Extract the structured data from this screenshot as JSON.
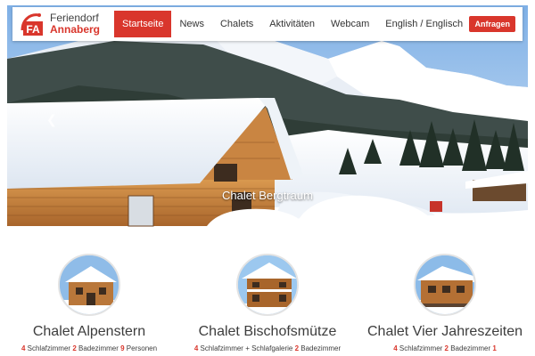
{
  "brand": {
    "line1": "Feriendorf",
    "line2": "Annaberg",
    "logo_letters": "FA"
  },
  "nav": {
    "items": [
      {
        "label": "Startseite",
        "active": true
      },
      {
        "label": "News",
        "active": false
      },
      {
        "label": "Chalets",
        "active": false
      },
      {
        "label": "Aktivitäten",
        "active": false
      },
      {
        "label": "Webcam",
        "active": false
      },
      {
        "label": "English / Englisch",
        "active": false
      }
    ],
    "cta_label": "Anfragen"
  },
  "hero": {
    "caption": "Chalet Bergtraum",
    "prev_icon": "chevron-left-icon"
  },
  "cards": [
    {
      "title": "Chalet Alpenstern",
      "meta": [
        {
          "num": "4",
          "text": " Schlafzimmer "
        },
        {
          "num": "2",
          "text": " Badezimmer "
        },
        {
          "num": "9",
          "text": " Personen"
        }
      ]
    },
    {
      "title": "Chalet Bischofsmütze",
      "meta": [
        {
          "num": "4",
          "text": " Schlafzimmer + Schlafgalerie "
        },
        {
          "num": "2",
          "text": " Badezimmer"
        }
      ]
    },
    {
      "title": "Chalet Vier Jahreszeiten",
      "meta": [
        {
          "num": "4",
          "text": " Schlafzimmer "
        },
        {
          "num": "2",
          "text": " Badezimmer "
        },
        {
          "num": "1",
          "text": ""
        }
      ]
    }
  ],
  "colors": {
    "accent": "#d9362c",
    "text": "#3d3d3d",
    "sky": "#8fb8e6",
    "wood": "#c98a4a"
  }
}
